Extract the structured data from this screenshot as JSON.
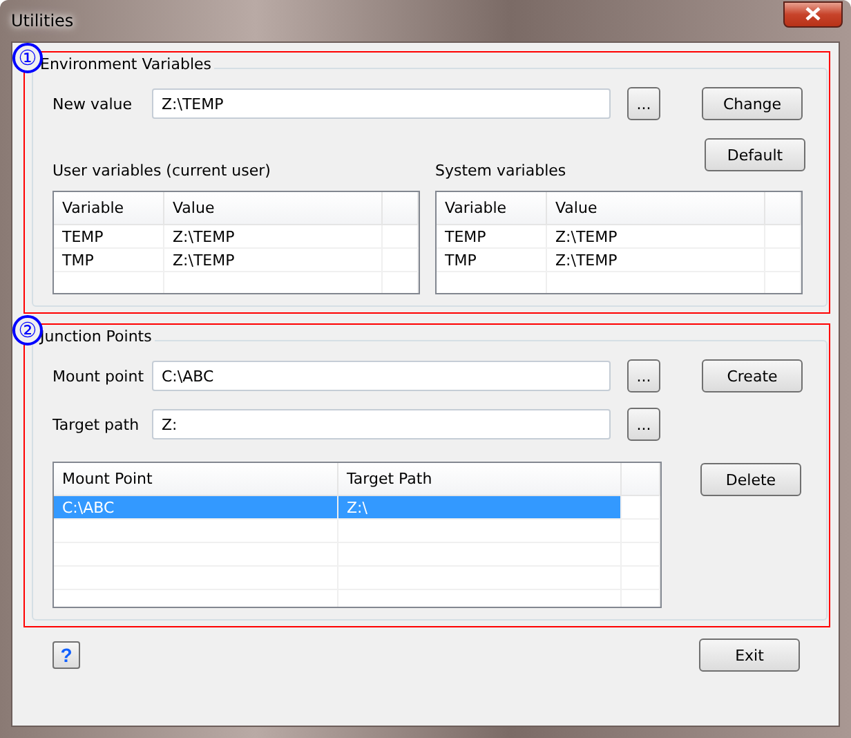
{
  "window": {
    "title": "Utilities"
  },
  "environment": {
    "marker": "①",
    "title": "Environment Variables",
    "new_value_label": "New value",
    "new_value": "Z:\\TEMP",
    "browse": "...",
    "change": "Change",
    "default": "Default",
    "user_title": "User variables (current user)",
    "system_title": "System variables",
    "user_table": {
      "columns": [
        "Variable",
        "Value"
      ],
      "rows": [
        {
          "cells": [
            "TEMP",
            "Z:\\TEMP"
          ],
          "selected": false
        },
        {
          "cells": [
            "TMP",
            "Z:\\TEMP"
          ],
          "selected": false
        }
      ]
    },
    "system_table": {
      "columns": [
        "Variable",
        "Value"
      ],
      "rows": [
        {
          "cells": [
            "TEMP",
            "Z:\\TEMP"
          ],
          "selected": false
        },
        {
          "cells": [
            "TMP",
            "Z:\\TEMP"
          ],
          "selected": false
        }
      ]
    }
  },
  "junction": {
    "marker": "②",
    "title": "Junction Points",
    "mount_label": "Mount point",
    "mount_value": "C:\\ABC",
    "target_label": "Target path",
    "target_value": "Z:",
    "browse": "...",
    "create": "Create",
    "delete": "Delete",
    "table": {
      "columns": [
        "Mount Point",
        "Target Path"
      ],
      "rows": [
        {
          "cells": [
            "C:\\ABC",
            "Z:\\"
          ],
          "selected": true
        }
      ]
    }
  },
  "footer": {
    "help": "?",
    "exit": "Exit"
  }
}
